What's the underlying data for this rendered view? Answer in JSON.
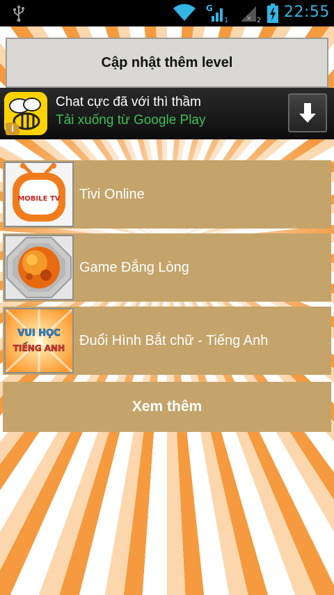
{
  "status_bar": {
    "time": "22:55",
    "sim2_label": "2",
    "icons": [
      "usb-icon",
      "wifi-icon",
      "signal-g-icon",
      "signal-no-sim-icon",
      "battery-charging-icon"
    ]
  },
  "header": {
    "update_button_label": "Cập nhật thêm level"
  },
  "ad_banner": {
    "title": "Chat cực đã với thì thầm",
    "subtitle": "Tải xuống từ Google Play",
    "badge": "i",
    "colors": {
      "title": "#ffffff",
      "subtitle": "#3fbf5a",
      "icon_bg": "#ffd200"
    }
  },
  "apps": [
    {
      "name": "Tivi Online",
      "thumb_icon": "mobile-tv-icon",
      "thumb_text": "MOBILE TV"
    },
    {
      "name": "Game Đắng Lòng",
      "thumb_icon": "orange-planet-icon"
    },
    {
      "name": "Đuổi Hình Bắt chữ - Tiếng Anh",
      "thumb_icon": "vui-hoc-tieng-anh-icon",
      "thumb_text": [
        "VUI HỌC",
        "TIẾNG ANH"
      ]
    }
  ],
  "more_button_label": "Xem thêm",
  "colors": {
    "list_item_bg": "#c4a46a",
    "update_button_bg": "#d9d8d5",
    "status_icon": "#33b5e5",
    "background_burst": "#f59a3e"
  }
}
